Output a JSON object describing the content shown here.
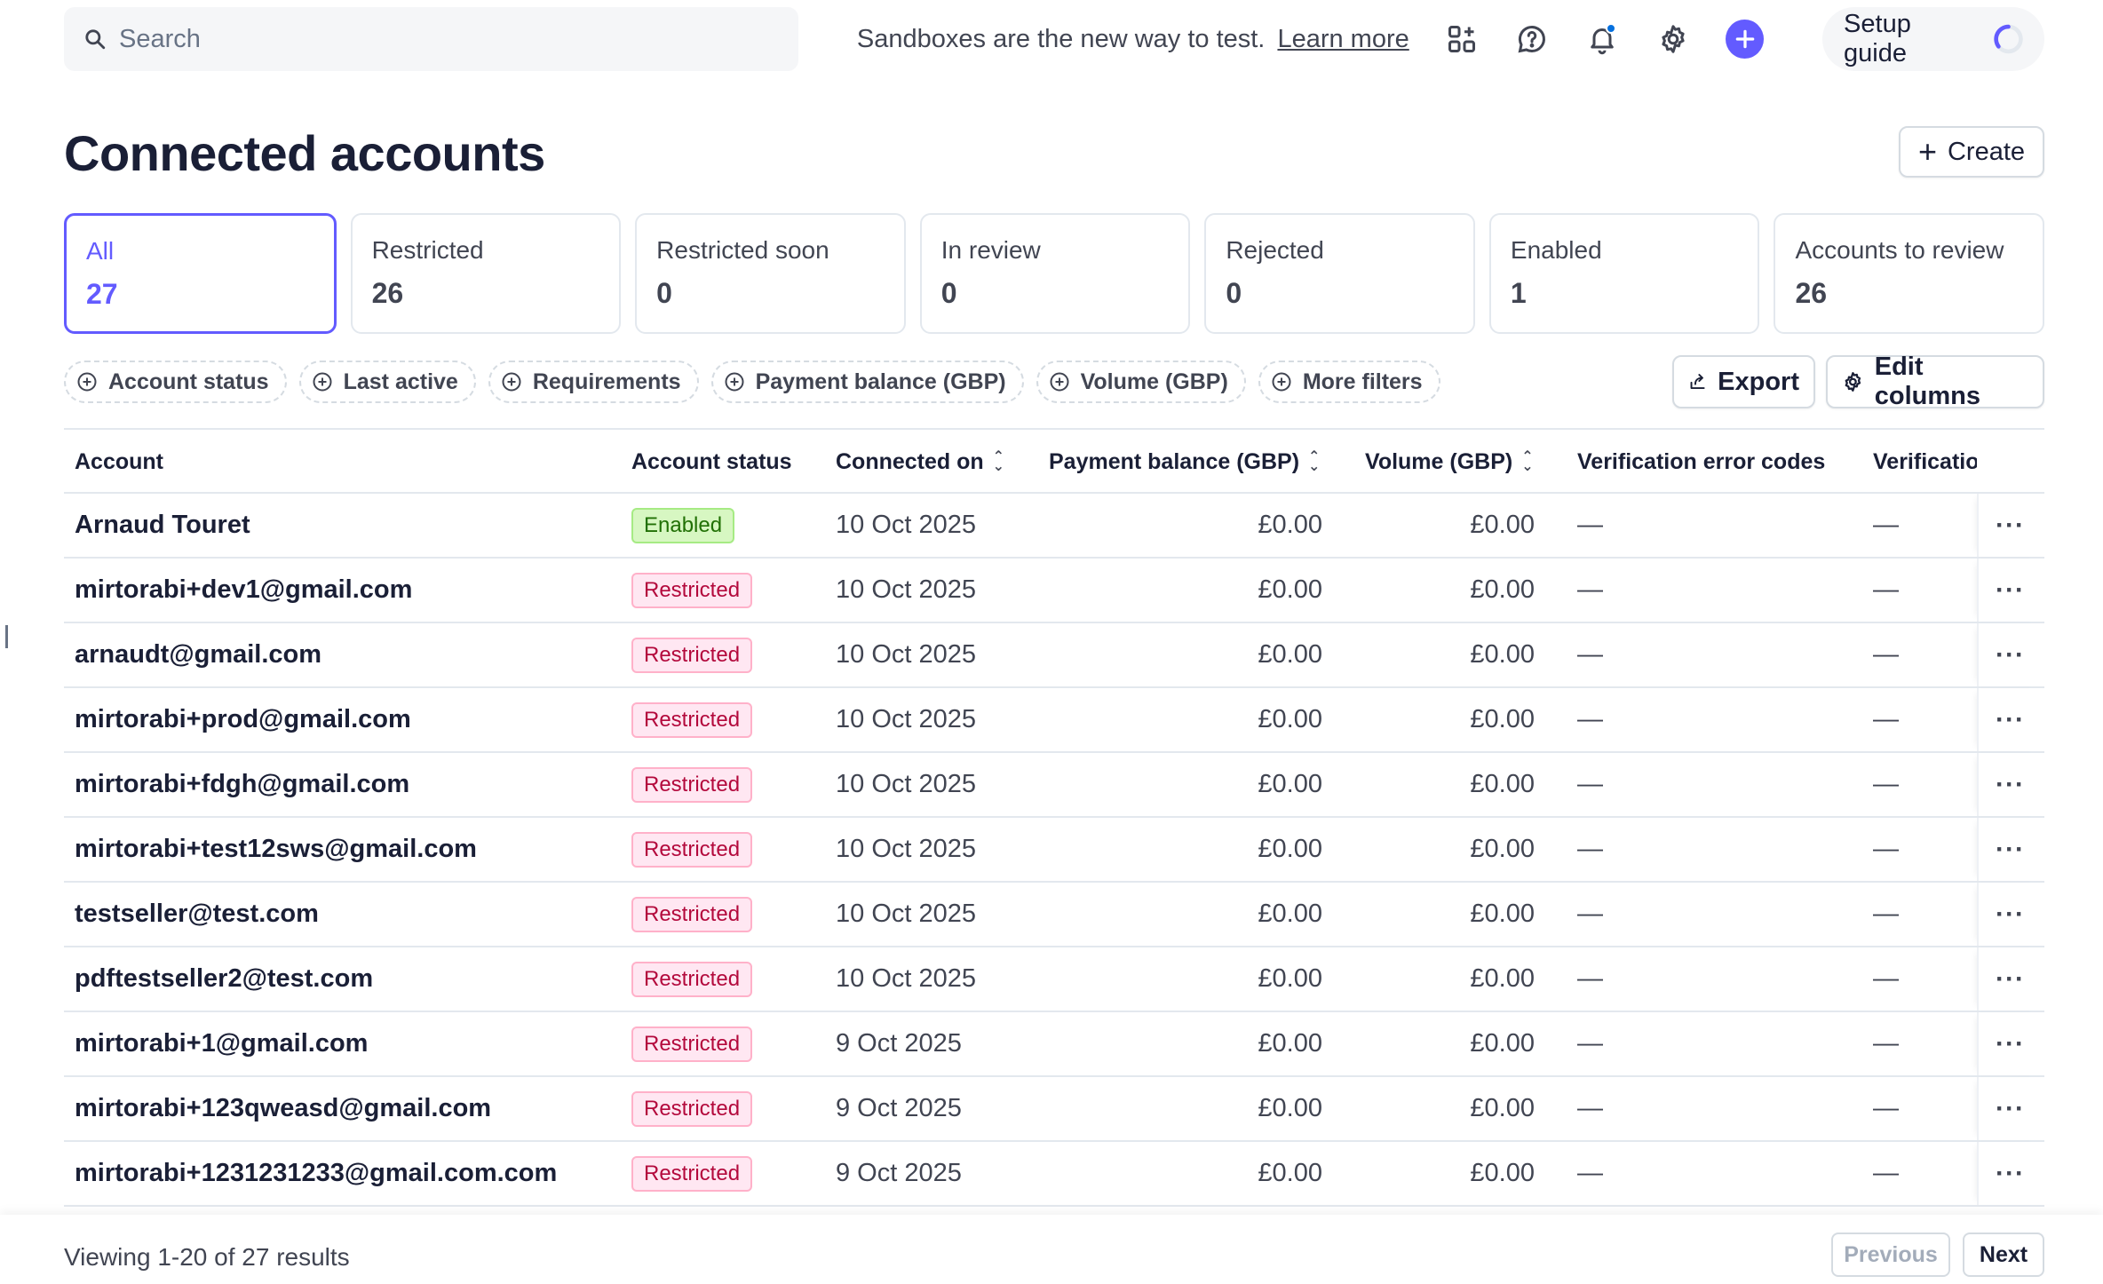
{
  "topbar": {
    "search_placeholder": "Search",
    "sandbox_text": "Sandboxes are the new way to test.",
    "learn_more": "Learn more",
    "setup_guide": "Setup guide"
  },
  "page": {
    "title": "Connected accounts",
    "create_label": "Create"
  },
  "cards": [
    {
      "label": "All",
      "count": "27"
    },
    {
      "label": "Restricted",
      "count": "26"
    },
    {
      "label": "Restricted soon",
      "count": "0"
    },
    {
      "label": "In review",
      "count": "0"
    },
    {
      "label": "Rejected",
      "count": "0"
    },
    {
      "label": "Enabled",
      "count": "1"
    },
    {
      "label": "Accounts to review",
      "count": "26"
    }
  ],
  "filters": [
    "Account status",
    "Last active",
    "Requirements",
    "Payment balance (GBP)",
    "Volume (GBP)",
    "More filters"
  ],
  "actions": {
    "export": "Export",
    "edit_columns": "Edit columns"
  },
  "table": {
    "headers": [
      "Account",
      "Account status",
      "Connected on",
      "Payment balance (GBP)",
      "Volume (GBP)",
      "Verification error codes",
      "Verificatio"
    ],
    "rows": [
      {
        "account": "Arnaud Touret",
        "status": "Enabled",
        "connected": "10 Oct 2025",
        "balance": "£0.00",
        "volume": "£0.00",
        "err": "—",
        "ver": "—"
      },
      {
        "account": "mirtorabi+dev1@gmail.com",
        "status": "Restricted",
        "connected": "10 Oct 2025",
        "balance": "£0.00",
        "volume": "£0.00",
        "err": "—",
        "ver": "—"
      },
      {
        "account": "arnaudt@gmail.com",
        "status": "Restricted",
        "connected": "10 Oct 2025",
        "balance": "£0.00",
        "volume": "£0.00",
        "err": "—",
        "ver": "—"
      },
      {
        "account": "mirtorabi+prod@gmail.com",
        "status": "Restricted",
        "connected": "10 Oct 2025",
        "balance": "£0.00",
        "volume": "£0.00",
        "err": "—",
        "ver": "—"
      },
      {
        "account": "mirtorabi+fdgh@gmail.com",
        "status": "Restricted",
        "connected": "10 Oct 2025",
        "balance": "£0.00",
        "volume": "£0.00",
        "err": "—",
        "ver": "—"
      },
      {
        "account": "mirtorabi+test12sws@gmail.com",
        "status": "Restricted",
        "connected": "10 Oct 2025",
        "balance": "£0.00",
        "volume": "£0.00",
        "err": "—",
        "ver": "—"
      },
      {
        "account": "testseller@test.com",
        "status": "Restricted",
        "connected": "10 Oct 2025",
        "balance": "£0.00",
        "volume": "£0.00",
        "err": "—",
        "ver": "—"
      },
      {
        "account": "pdftestseller2@test.com",
        "status": "Restricted",
        "connected": "10 Oct 2025",
        "balance": "£0.00",
        "volume": "£0.00",
        "err": "—",
        "ver": "—"
      },
      {
        "account": "mirtorabi+1@gmail.com",
        "status": "Restricted",
        "connected": "9 Oct 2025",
        "balance": "£0.00",
        "volume": "£0.00",
        "err": "—",
        "ver": "—"
      },
      {
        "account": "mirtorabi+123qweasd@gmail.com",
        "status": "Restricted",
        "connected": "9 Oct 2025",
        "balance": "£0.00",
        "volume": "£0.00",
        "err": "—",
        "ver": "—"
      },
      {
        "account": "mirtorabi+1231231233@gmail.com.com",
        "status": "Restricted",
        "connected": "9 Oct 2025",
        "balance": "£0.00",
        "volume": "£0.00",
        "err": "—",
        "ver": "—"
      }
    ]
  },
  "footer": {
    "viewing": "Viewing 1-20 of 27 results",
    "previous": "Previous",
    "next": "Next"
  },
  "colors": {
    "accent": "#635bff",
    "enabled": "#217005",
    "restricted": "#b3093c"
  }
}
